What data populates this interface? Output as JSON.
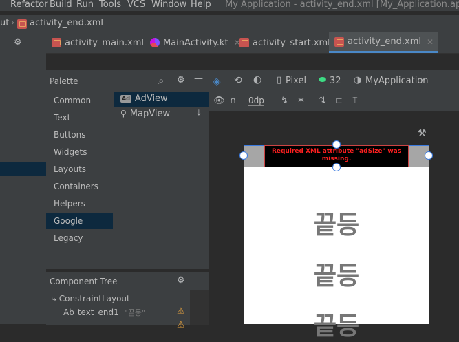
{
  "menubar": {
    "items": [
      "Refactor",
      "Build",
      "Run",
      "Tools",
      "VCS",
      "Window",
      "Help"
    ],
    "window_title": "My Application - activity_end.xml [My_Application.app]"
  },
  "breadcrumb": {
    "prefix": "ut",
    "file": "activity_end.xml"
  },
  "tabs": [
    {
      "label": "activity_main.xml",
      "icon": "xml-file-icon",
      "active": false
    },
    {
      "label": "MainActivity.kt",
      "icon": "kotlin-file-icon",
      "active": false
    },
    {
      "label": "activity_start.xml",
      "icon": "xml-file-icon",
      "active": false
    },
    {
      "label": "activity_end.xml",
      "icon": "xml-file-icon",
      "active": true
    }
  ],
  "palette": {
    "title": "Palette",
    "categories": [
      "Common",
      "Text",
      "Buttons",
      "Widgets",
      "Layouts",
      "Containers",
      "Helpers",
      "Google",
      "Legacy"
    ],
    "selected_category": "Google",
    "items": [
      {
        "label": "AdView",
        "badge": "Ad",
        "selected": true
      },
      {
        "label": "MapView",
        "selected": false
      }
    ]
  },
  "component_tree": {
    "title": "Component Tree",
    "root": "ConstraintLayout",
    "children": [
      {
        "badge": "Ab",
        "label": "text_end1",
        "value": "\"끝둥\"",
        "warning": true
      }
    ]
  },
  "design_toolbar": {
    "device": "Pixel",
    "api_level": "32",
    "theme": "MyApplication",
    "margin": "0dp"
  },
  "preview": {
    "ad_error": "Required XML attribute \"adSize\" was missing.",
    "texts": [
      "끝등",
      "끝등",
      "끝등"
    ]
  },
  "colors": {
    "accent": "#4a88c7",
    "selection": "#0d293e",
    "error": "#ff2020",
    "warning": "#e8a33e"
  }
}
